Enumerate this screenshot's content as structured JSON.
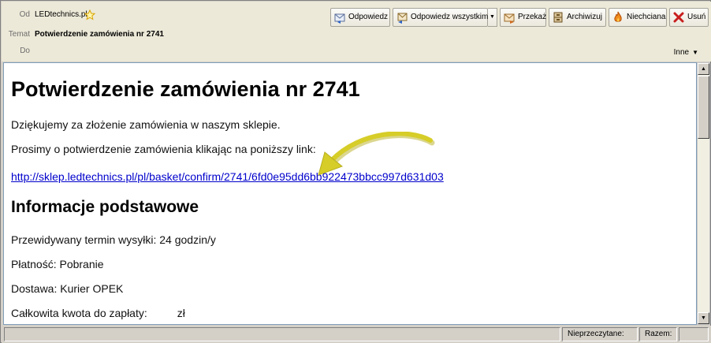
{
  "header": {
    "from_label": "Od",
    "from_value": "LEDtechnics.pl",
    "subject_label": "Temat",
    "subject_value": "Potwierdzenie zamówienia nr 2741",
    "to_label": "Do",
    "more_label": "Inne"
  },
  "toolbar": {
    "reply": "Odpowiedz",
    "reply_all": "Odpowiedz wszystkim",
    "forward": "Przekaż",
    "archive": "Archiwizuj",
    "junk": "Niechciana",
    "delete": "Usuń"
  },
  "message": {
    "title": "Potwierdzenie zamówienia nr 2741",
    "thanks": "Dziękujemy za złożenie zamówienia w naszym sklepie.",
    "confirm_prompt": "Prosimy o potwierdzenie zamówienia klikając na poniższy link:",
    "confirm_link": "http://sklep.ledtechnics.pl/pl/basket/confirm/2741/6fd0e95dd6bb922473bbcc997d631d03",
    "section_title": "Informacje podstawowe",
    "shipping_time": "Przewidywany termin wysyłki: 24 godzin/y",
    "payment": "Płatność: Pobranie",
    "delivery": "Dostawa: Kurier OPEK",
    "total_label": "Całkowita kwota do zapłaty:",
    "total_currency": "zł"
  },
  "statusbar": {
    "unread_label": "Nieprzeczytane:",
    "total_label": "Razem:"
  },
  "colors": {
    "link": "#0000cc",
    "arrow": "#c9c21e",
    "header_bg": "#ece9d8"
  }
}
